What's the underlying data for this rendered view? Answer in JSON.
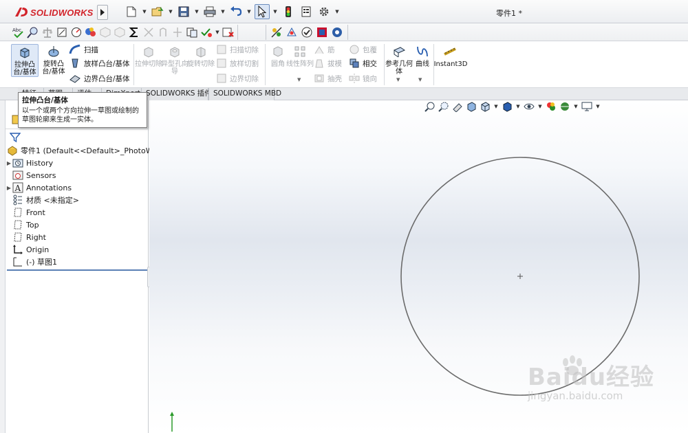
{
  "app": {
    "logo_text": "SOLIDWORKS",
    "doc_title": "零件1 *"
  },
  "toolbar2": {
    "spell_label": "Abc"
  },
  "ribbon": {
    "extrude_boss": "拉伸凸台/基体",
    "revolve_boss": "旋转凸台/基体",
    "sweep": "扫描",
    "loft": "放样凸台/基体",
    "boundary_boss": "边界凸台/基体",
    "extruded_cut": "拉伸切除",
    "hole_wizard": "异型孔向导",
    "revolved_cut": "旋转切除",
    "swept_cut": "扫描切除",
    "lofted_cut": "放样切割",
    "boundary_cut": "边界切除",
    "fillet": "圆角",
    "linear_pattern": "线性阵列",
    "rib": "筋",
    "draft": "拔模",
    "shell": "抽壳",
    "wrap": "包覆",
    "intersect": "相交",
    "mirror": "镜向",
    "ref_geometry": "参考几何体",
    "curves": "曲线",
    "instant3d": "Instant3D"
  },
  "tabs": {
    "features": "特征",
    "sketch": "草图",
    "evaluate": "评估",
    "dimxpert": "DimXpert",
    "addins": "SOLIDWORKS 插件",
    "mbd": "SOLIDWORKS MBD"
  },
  "tooltip": {
    "title": "拉伸凸台/基体",
    "body": "以一个或两个方向拉伸一草图或绘制的草图轮廓来生成一实体。"
  },
  "tree": {
    "root": "零件1  (Default<<Default>_PhotoWorks",
    "history": "History",
    "sensors": "Sensors",
    "annotations": "Annotations",
    "material": "材质 <未指定>",
    "front": "Front",
    "top": "Top",
    "right": "Right",
    "origin": "Origin",
    "sketch1": "(-) 草图1"
  },
  "watermark": {
    "main": "Baidu经验",
    "sub": "jingyan.baidu.com"
  },
  "colors": {
    "brand_red": "#d2232a",
    "selection_blue": "#5a7fb5",
    "sketch_line": "#6b6b6b"
  }
}
